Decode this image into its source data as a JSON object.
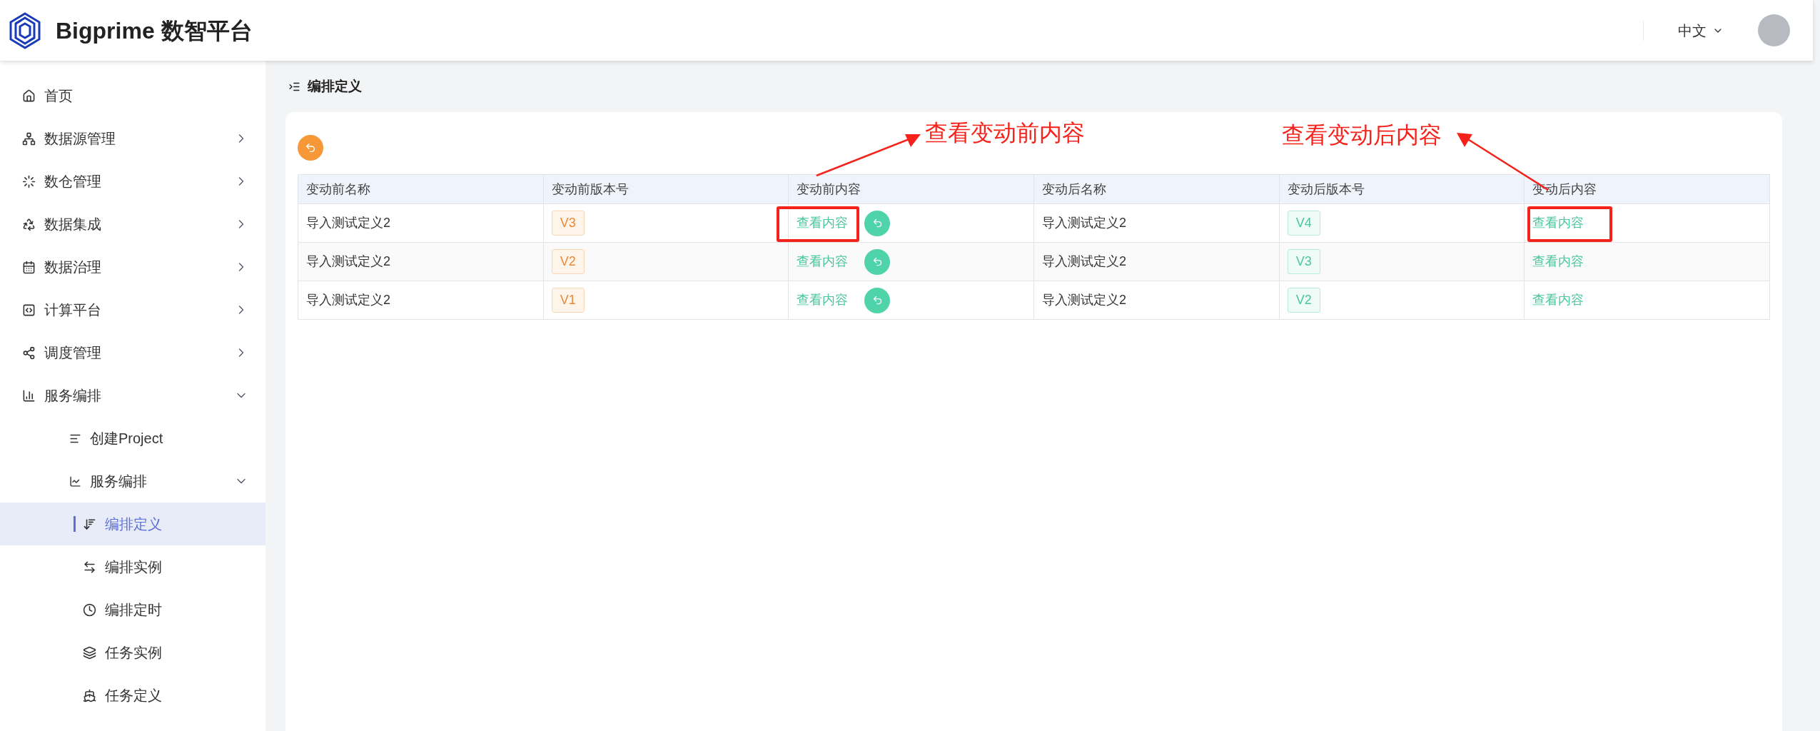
{
  "header": {
    "brand": "Bigprime 数智平台",
    "language": "中文"
  },
  "sidebar": {
    "items": [
      {
        "label": "首页",
        "kind": "link"
      },
      {
        "label": "数据源管理",
        "kind": "group",
        "expanded": false
      },
      {
        "label": "数仓管理",
        "kind": "group",
        "expanded": false
      },
      {
        "label": "数据集成",
        "kind": "group",
        "expanded": false
      },
      {
        "label": "数据治理",
        "kind": "group",
        "expanded": false
      },
      {
        "label": "计算平台",
        "kind": "group",
        "expanded": false
      },
      {
        "label": "调度管理",
        "kind": "group",
        "expanded": false
      },
      {
        "label": "服务编排",
        "kind": "group",
        "expanded": true,
        "children": [
          {
            "label": "创建Project",
            "kind": "link"
          },
          {
            "label": "服务编排",
            "kind": "group",
            "expanded": true,
            "children": [
              {
                "label": "编排定义",
                "selected": true
              },
              {
                "label": "编排实例",
                "selected": false
              },
              {
                "label": "编排定时",
                "selected": false
              },
              {
                "label": "任务实例",
                "selected": false
              },
              {
                "label": "任务定义",
                "selected": false
              }
            ]
          }
        ]
      }
    ]
  },
  "breadcrumb": "编排定义",
  "table": {
    "columns": [
      "变动前名称",
      "变动前版本号",
      "变动前内容",
      "变动后名称",
      "变动后版本号",
      "变动后内容"
    ],
    "rows": [
      {
        "before_name": "导入测试定义2",
        "before_version": "V3",
        "before_link": "查看内容",
        "after_name": "导入测试定义2",
        "after_version": "V4",
        "after_link": "查看内容"
      },
      {
        "before_name": "导入测试定义2",
        "before_version": "V2",
        "before_link": "查看内容",
        "after_name": "导入测试定义2",
        "after_version": "V3",
        "after_link": "查看内容"
      },
      {
        "before_name": "导入测试定义2",
        "before_version": "V1",
        "before_link": "查看内容",
        "after_name": "导入测试定义2",
        "after_version": "V2",
        "after_link": "查看内容"
      }
    ]
  },
  "annotations": [
    {
      "text": "查看变动前内容"
    },
    {
      "text": "查看变动后内容"
    }
  ]
}
